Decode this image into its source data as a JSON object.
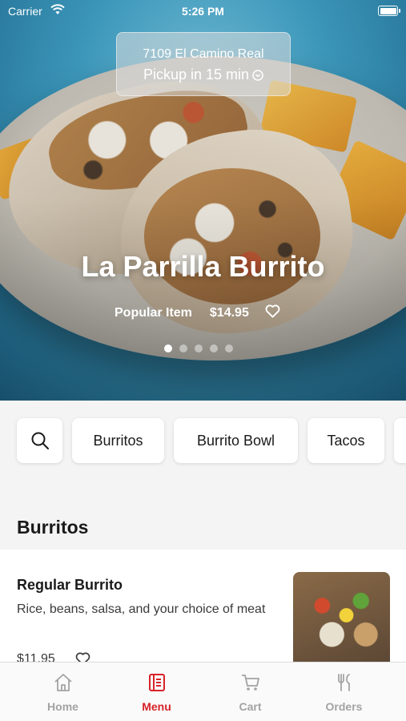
{
  "status_bar": {
    "carrier": "Carrier",
    "time": "5:26 PM"
  },
  "location": {
    "address": "7109 El Camino Real",
    "pickup": "Pickup in 15 min"
  },
  "hero": {
    "title": "La Parrilla Burrito",
    "tag": "Popular Item",
    "price": "$14.95",
    "carousel_count": 5,
    "carousel_active": 0
  },
  "categories": [
    "Burritos",
    "Burrito Bowl",
    "Tacos"
  ],
  "section": {
    "title": "Burritos"
  },
  "items": [
    {
      "name": "Regular Burrito",
      "description": "Rice, beans, salsa, and your choice of meat",
      "price": "$11.95"
    }
  ],
  "tabs": [
    {
      "label": "Home",
      "icon": "home-icon"
    },
    {
      "label": "Menu",
      "icon": "menu-icon",
      "active": true
    },
    {
      "label": "Cart",
      "icon": "cart-icon"
    },
    {
      "label": "Orders",
      "icon": "utensils-icon"
    }
  ],
  "colors": {
    "accent": "#d8232a",
    "inactive": "#a3a3a3"
  }
}
